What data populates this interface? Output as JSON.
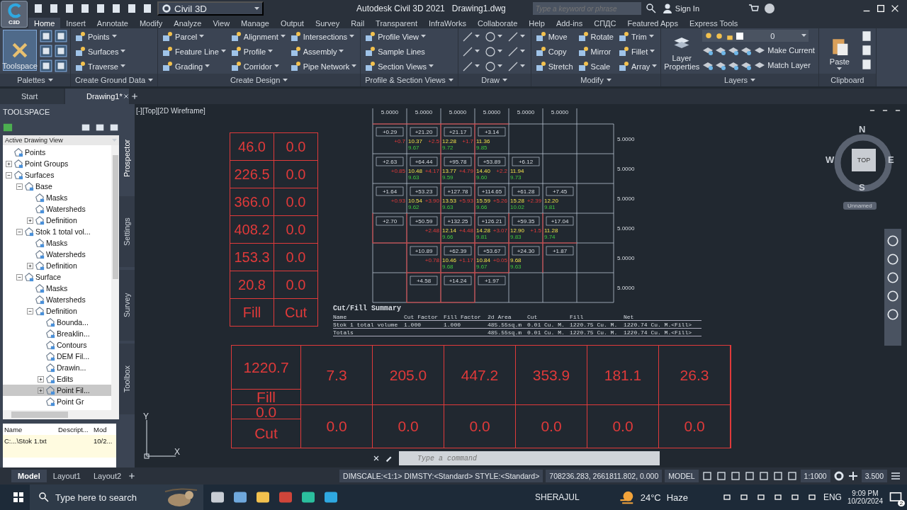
{
  "title_bar": {
    "app_button": "C3D",
    "workspace": "Civil 3D",
    "app_title": "Autodesk Civil 3D 2021",
    "file_name": "Drawing1.dwg",
    "search_placeholder": "Type a keyword or phrase",
    "sign_in": "Sign In"
  },
  "ribbon_tabs": [
    {
      "label": "Home",
      "selected": true
    },
    {
      "label": "Insert",
      "selected": false
    },
    {
      "label": "Annotate",
      "selected": false
    },
    {
      "label": "Modify",
      "selected": false
    },
    {
      "label": "Analyze",
      "selected": false
    },
    {
      "label": "View",
      "selected": false
    },
    {
      "label": "Manage",
      "selected": false
    },
    {
      "label": "Output",
      "selected": false
    },
    {
      "label": "Survey",
      "selected": false
    },
    {
      "label": "Rail",
      "selected": false
    },
    {
      "label": "Transparent",
      "selected": false
    },
    {
      "label": "InfraWorks",
      "selected": false
    },
    {
      "label": "Collaborate",
      "selected": false
    },
    {
      "label": "Help",
      "selected": false
    },
    {
      "label": "Add-ins",
      "selected": false
    },
    {
      "label": "СПДС",
      "selected": false
    },
    {
      "label": "Featured Apps",
      "selected": false
    },
    {
      "label": "Express Tools",
      "selected": false
    }
  ],
  "ribbon_panels": [
    {
      "title": "Palettes",
      "kind": "palettes",
      "big": "Toolspace"
    },
    {
      "title": "Create Ground Data",
      "kind": "list",
      "columns": [
        [
          {
            "label": "Points",
            "menu": true
          },
          {
            "label": "Surfaces",
            "menu": true
          },
          {
            "label": "Traverse",
            "menu": true
          }
        ]
      ]
    },
    {
      "title": "Create Design",
      "kind": "list",
      "columns": [
        [
          {
            "label": "Parcel",
            "menu": true
          },
          {
            "label": "Feature Line",
            "menu": true
          },
          {
            "label": "Grading",
            "menu": true
          }
        ],
        [
          {
            "label": "Alignment",
            "menu": true
          },
          {
            "label": "Profile",
            "menu": true
          },
          {
            "label": "Corridor",
            "menu": true
          }
        ],
        [
          {
            "label": "Intersections",
            "menu": true
          },
          {
            "label": "Assembly",
            "menu": true
          },
          {
            "label": "Pipe Network",
            "menu": true
          }
        ]
      ]
    },
    {
      "title": "Profile & Section Views",
      "kind": "list",
      "columns": [
        [
          {
            "label": "Profile View",
            "menu": true
          },
          {
            "label": "Sample Lines",
            "menu": false
          },
          {
            "label": "Section Views",
            "menu": true
          }
        ]
      ]
    },
    {
      "title": "Draw",
      "kind": "draw"
    },
    {
      "title": "Modify",
      "kind": "list",
      "columns": [
        [
          {
            "label": "Move",
            "menu": false
          },
          {
            "label": "Copy",
            "menu": false
          },
          {
            "label": "Stretch",
            "menu": false
          }
        ],
        [
          {
            "label": "Rotate",
            "menu": false
          },
          {
            "label": "Mirror",
            "menu": false
          },
          {
            "label": "Scale",
            "menu": false
          }
        ],
        [
          {
            "label": "Trim",
            "menu": true
          },
          {
            "label": "Fillet",
            "menu": true
          },
          {
            "label": "Array",
            "menu": true
          }
        ]
      ]
    },
    {
      "title": "Layers",
      "kind": "layers",
      "big": "Layer Properties",
      "layer": "0",
      "actions": [
        "Make Current",
        "Match Layer"
      ]
    },
    {
      "title": "Clipboard",
      "kind": "clipboard",
      "big": "Paste"
    }
  ],
  "file_tabs": [
    {
      "label": "Start",
      "selected": false
    },
    {
      "label": "Drawing1*",
      "selected": true
    }
  ],
  "toolspace": {
    "title": "TOOLSPACE",
    "view": "Active Drawing View",
    "tree": [
      {
        "label": "Points",
        "selected": false
      },
      {
        "label": "Point Groups",
        "selected": false,
        "expanded": false
      },
      {
        "label": "Surfaces",
        "selected": false,
        "expanded": true,
        "children": [
          {
            "label": "Base",
            "selected": false,
            "expanded": true,
            "children": [
              {
                "label": "Masks",
                "selected": false
              },
              {
                "label": "Watersheds",
                "selected": false
              },
              {
                "label": "Definition",
                "selected": false,
                "expanded": false
              }
            ]
          },
          {
            "label": "Stok 1 total vol...",
            "selected": false,
            "expanded": true,
            "children": [
              {
                "label": "Masks",
                "selected": false
              },
              {
                "label": "Watersheds",
                "selected": false
              },
              {
                "label": "Definition",
                "selected": false,
                "expanded": false
              }
            ]
          },
          {
            "label": "Surface",
            "selected": false,
            "expanded": true,
            "children": [
              {
                "label": "Masks",
                "selected": false
              },
              {
                "label": "Watersheds",
                "selected": false
              },
              {
                "label": "Definition",
                "selected": false,
                "expanded": true,
                "children": [
                  {
                    "label": "Bounda...",
                    "selected": false
                  },
                  {
                    "label": "Breaklin...",
                    "selected": false
                  },
                  {
                    "label": "Contours",
                    "selected": false
                  },
                  {
                    "label": "DEM Fil...",
                    "selected": false
                  },
                  {
                    "label": "Drawin...",
                    "selected": false
                  },
                  {
                    "label": "Edits",
                    "selected": false,
                    "expanded": false
                  },
                  {
                    "label": "Point Fil...",
                    "selected": true,
                    "expanded": false
                  },
                  {
                    "label": "Point Gr",
                    "selected": false
                  }
                ]
              }
            ]
          }
        ]
      }
    ],
    "side_tabs": [
      {
        "label": "Prospector",
        "selected": true
      },
      {
        "label": "Settings",
        "selected": false
      },
      {
        "label": "Survey",
        "selected": false
      },
      {
        "label": "Toolbox",
        "selected": false
      }
    ],
    "list": {
      "columns": [
        "Name",
        "Descript...",
        "Mod"
      ],
      "rows": [
        {
          "name": "C:...\\Stok 1.txt",
          "mod": "10/2..."
        }
      ]
    }
  },
  "viewport": {
    "label": "[-][Top][2D Wireframe]"
  },
  "viewcube": {
    "north": "N",
    "south": "S",
    "east": "E",
    "west": "W",
    "face": "TOP",
    "view_name": "Unnamed"
  },
  "ucs": {
    "x": "X",
    "y": "Y"
  },
  "left_table": [
    [
      "46.0",
      "0.0"
    ],
    [
      "226.5",
      "0.0"
    ],
    [
      "366.0",
      "0.0"
    ],
    [
      "408.2",
      "0.0"
    ],
    [
      "153.3",
      "0.0"
    ],
    [
      "20.8",
      "0.0"
    ],
    [
      "Fill",
      "Cut"
    ]
  ],
  "grid_drawing": {
    "top_labels": [
      "5.0000",
      "5.0000",
      "5.0000",
      "5.0000",
      "5.0000",
      "5.0000"
    ],
    "side_labels": [
      "5.0000",
      "5.0000",
      "5.0000",
      "5.0000",
      "5.0000",
      "5.0000"
    ],
    "boxes": [
      [
        {
          "kind": "volume",
          "label": "+0.29"
        },
        {
          "kind": "volume",
          "label": "+21.20"
        },
        {
          "kind": "volume",
          "label": "+21.17"
        },
        {
          "kind": "volume",
          "label": "+3.14"
        }
      ],
      [
        {
          "kind": "volume",
          "label": "+2.63"
        },
        {
          "kind": "volume",
          "label": "+64.44"
        },
        {
          "kind": "volume",
          "label": "+95.78"
        },
        {
          "kind": "volume",
          "label": "+53.89"
        },
        {
          "kind": "volume",
          "label": "+6.12"
        }
      ],
      [
        {
          "kind": "volume",
          "label": "+1.64"
        },
        {
          "kind": "volume",
          "label": "+53.23"
        },
        {
          "kind": "volume",
          "label": "+127.78"
        },
        {
          "kind": "volume",
          "label": "+114.65"
        },
        {
          "kind": "volume",
          "label": "+61.28"
        },
        {
          "kind": "volume",
          "label": "+7.45"
        }
      ],
      [
        {
          "kind": "volume",
          "label": "+2.70"
        },
        {
          "kind": "volume",
          "label": "+50.59"
        },
        {
          "kind": "volume",
          "label": "+132.25"
        },
        {
          "kind": "volume",
          "label": "+126.21"
        },
        {
          "kind": "volume",
          "label": "+59.35"
        },
        {
          "kind": "volume",
          "label": "+17.04"
        }
      ],
      [
        {
          "kind": "blank"
        },
        {
          "kind": "volume",
          "label": "+10.89"
        },
        {
          "kind": "volume",
          "label": "+62.39"
        },
        {
          "kind": "volume",
          "label": "+53.67"
        },
        {
          "kind": "volume",
          "label": "+24.30"
        },
        {
          "kind": "volume",
          "label": "+1.87"
        }
      ],
      [
        {
          "kind": "blank"
        },
        {
          "kind": "volume",
          "label": "+4.58"
        },
        {
          "kind": "volume",
          "label": "+14.24"
        },
        {
          "kind": "volume",
          "label": "+1.97"
        }
      ]
    ],
    "vertices": [
      {
        "kind": "full",
        "points": [
          {
            "cut": "+0.7",
            "elev": "10.37",
            "base": "9.67"
          },
          {
            "cut": "+2.5",
            "elev": "12.28",
            "base": "9.72"
          },
          {
            "cut": "+1.7",
            "elev": "11.36",
            "base": "9.85"
          }
        ]
      },
      {
        "kind": "full",
        "points": [
          {
            "cut": "+0.85",
            "elev": "10.48",
            "base": "9.63"
          },
          {
            "cut": "+4.17",
            "elev": "13.77",
            "base": "9.59"
          },
          {
            "cut": "+4.79",
            "elev": "14.40",
            "base": "9.60"
          },
          {
            "cut": "+2.2",
            "elev": "11.94",
            "base": "9.73"
          }
        ]
      },
      {
        "kind": "full",
        "points": [
          {
            "cut": "+0.93",
            "elev": "10.54",
            "base": "9.62"
          },
          {
            "cut": "+3.90",
            "elev": "13.53",
            "base": "9.63"
          },
          {
            "cut": "+5.93",
            "elev": "15.59",
            "base": "9.66"
          },
          {
            "cut": "+5.26",
            "elev": "15.28",
            "base": "10.02"
          },
          {
            "cut": "+2.39",
            "elev": "12.20",
            "base": "9.81"
          }
        ]
      },
      {
        "kind": "shifted",
        "points": [
          {
            "cut": "+2.48",
            "elev": "12.14",
            "base": "9.66"
          },
          {
            "cut": "+4.48",
            "elev": "14.28",
            "base": "9.81"
          },
          {
            "cut": "+3.07",
            "elev": "12.90",
            "base": "9.83"
          },
          {
            "cut": "+1.5",
            "elev": "11.28",
            "base": "9.74"
          }
        ]
      },
      {
        "kind": "shifted",
        "points": [
          {
            "cut": "+0.78",
            "elev": "10.46",
            "base": "9.68"
          },
          {
            "cut": "+1.17",
            "elev": "10.84",
            "base": "9.67"
          },
          {
            "cut": "+0.05",
            "elev": "9.68",
            "base": "9.63"
          }
        ]
      }
    ]
  },
  "summary": {
    "title": "Cut/Fill Summary",
    "columns": [
      "Name",
      "Cut Factor",
      "Fill Factor",
      "2d Area",
      "Cut",
      "Fill",
      "Net"
    ],
    "rows": [
      {
        "name": "Stok 1 total volume",
        "cut_factor": "1.000",
        "fill_factor": "1.000",
        "area": "485.55sq.m",
        "cut": "0.01 Cu. M.",
        "fill": "1220.75 Cu. M.",
        "net": "1220.74 Cu. M.<Fill>"
      },
      {
        "name": "Totals",
        "area": "485.55sq.m",
        "cut": "0.01 Cu. M.",
        "fill": "1220.75 Cu. M.",
        "net": "1220.74 Cu. M.<Fill>"
      }
    ]
  },
  "bottom_table": {
    "fill_total": "1220.7",
    "fill_label": "Fill",
    "cut_total": "0.0",
    "cut_label": "Cut",
    "fill_values": [
      "7.3",
      "205.0",
      "447.2",
      "353.9",
      "181.1",
      "26.3"
    ],
    "cut_values": [
      "0.0",
      "0.0",
      "0.0",
      "0.0",
      "0.0",
      "0.0"
    ]
  },
  "command_line": {
    "placeholder": "Type a command"
  },
  "layout_tabs": [
    {
      "label": "Model",
      "selected": true
    },
    {
      "label": "Layout1",
      "selected": false
    },
    {
      "label": "Layout2",
      "selected": false
    }
  ],
  "status_bar": {
    "styles": "DIMSCALE:<1:1> DIMSTY:<Standard> STYLE:<Standard>",
    "coordinates": "708236.283, 2661811.802, 0.000",
    "space": "MODEL",
    "scale": "1:1000",
    "value": "3.500"
  },
  "taskbar": {
    "search_placeholder": "Type here to search",
    "user": "SHERAJUL",
    "temperature": "24°C",
    "weather": "Haze",
    "language": "ENG",
    "time": "9:09 PM",
    "date": "10/20/2024",
    "notifications": "2"
  }
}
